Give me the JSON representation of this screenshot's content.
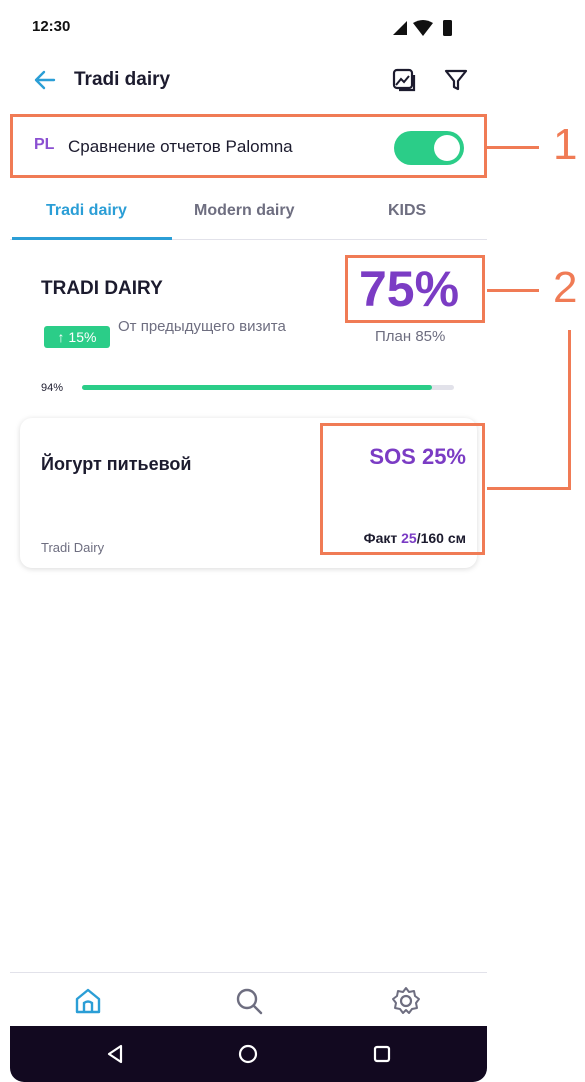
{
  "status_bar": {
    "time": "12:30"
  },
  "header": {
    "title": "Tradi dairy"
  },
  "compare": {
    "prefix": "PL",
    "label": "Сравнение отчетов Palomna",
    "toggle_on": true
  },
  "tabs": [
    {
      "label": "Tradi dairy",
      "active": true
    },
    {
      "label": "Modern dairy",
      "active": false
    },
    {
      "label": "KIDS",
      "active": false
    }
  ],
  "summary": {
    "title": "TRADI DAIRY",
    "badge": "↑ 15%",
    "delta_text": "От предыдущего визита",
    "percent": "75%",
    "plan": "План 85%",
    "progress_label": "94%",
    "progress_value": 0.94
  },
  "card": {
    "name": "Йогурт питьевой",
    "brand": "Tradi Dairy",
    "sos": "SOS 25%",
    "fact_prefix": "Факт ",
    "fact_value": "25",
    "fact_suffix": "/160 см"
  },
  "callouts": [
    "1",
    "2"
  ],
  "colors": {
    "accent": "#2b9ed6",
    "purple": "#7b3cc4",
    "green": "#2bcd88",
    "annotation": "#f07b55"
  },
  "icons": {
    "back": "arrow-left-icon",
    "report": "chart-image-icon",
    "filter": "filter-icon",
    "home": "home-icon",
    "search": "search-icon",
    "settings": "gear-icon"
  }
}
